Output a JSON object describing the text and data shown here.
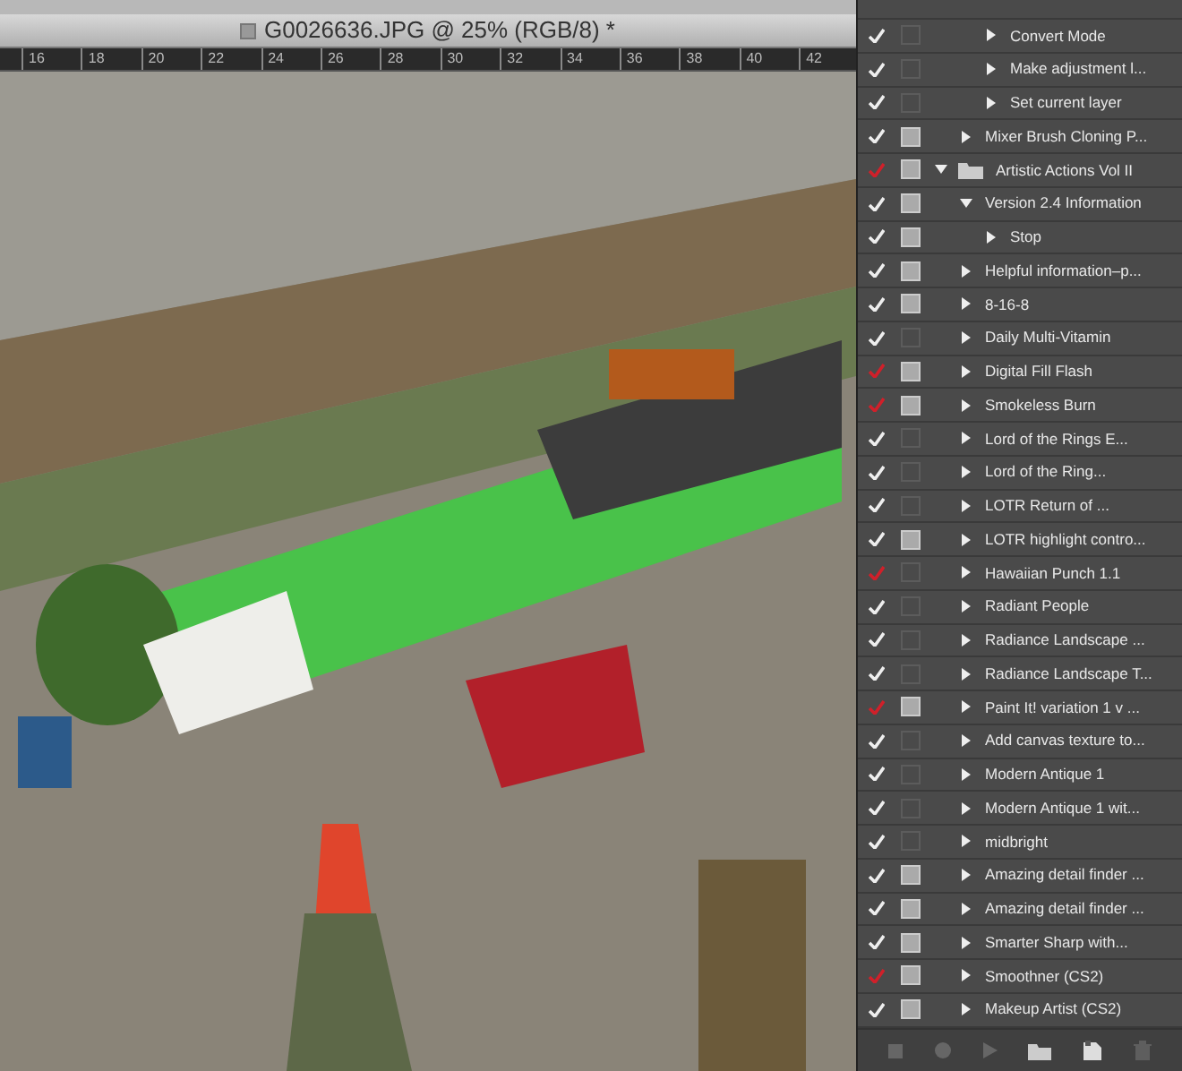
{
  "document": {
    "title": "G0026636.JPG @ 25% (RGB/8) *",
    "ruler_labels": [
      "16",
      "18",
      "20",
      "22",
      "24",
      "26",
      "28",
      "30",
      "32",
      "34",
      "36",
      "38",
      "40",
      "42"
    ],
    "kind": "picture"
  },
  "actions_panel": {
    "items": [
      {
        "kind": "step",
        "label": "Convert Mode",
        "enabled": true,
        "partially_enabled": false,
        "dialog": false,
        "expanded": false
      },
      {
        "kind": "step",
        "label": "Make adjustment l...",
        "enabled": true,
        "partially_enabled": false,
        "dialog": false,
        "expanded": false
      },
      {
        "kind": "step",
        "label": "Set current layer",
        "enabled": true,
        "partially_enabled": false,
        "dialog": false,
        "expanded": false
      },
      {
        "kind": "action",
        "label": "Mixer Brush Cloning P...",
        "enabled": true,
        "partially_enabled": false,
        "dialog": true,
        "expanded": false
      },
      {
        "kind": "set",
        "label": "Artistic Actions Vol II",
        "enabled": true,
        "partially_enabled": true,
        "dialog": true,
        "expanded": true,
        "children": [
          {
            "kind": "action",
            "label": "Version 2.4 Information",
            "enabled": true,
            "partially_enabled": false,
            "dialog": true,
            "expanded": true,
            "children": [
              {
                "kind": "step",
                "label": "Stop",
                "enabled": true,
                "partially_enabled": false,
                "dialog": true,
                "expanded": false
              }
            ]
          },
          {
            "kind": "action",
            "label": "Helpful information–p...",
            "enabled": true,
            "partially_enabled": false,
            "dialog": true,
            "expanded": false
          },
          {
            "kind": "action",
            "label": "8-16-8",
            "enabled": true,
            "partially_enabled": false,
            "dialog": true,
            "expanded": false
          },
          {
            "kind": "action",
            "label": "Daily Multi-Vitamin",
            "enabled": true,
            "partially_enabled": false,
            "dialog": false,
            "expanded": false
          },
          {
            "kind": "action",
            "label": "Digital Fill Flash",
            "enabled": true,
            "partially_enabled": true,
            "dialog": true,
            "expanded": false
          },
          {
            "kind": "action",
            "label": "Smokeless Burn",
            "enabled": true,
            "partially_enabled": true,
            "dialog": true,
            "expanded": false
          },
          {
            "kind": "action",
            "label": "Lord of the Rings E...",
            "enabled": true,
            "partially_enabled": false,
            "dialog": false,
            "expanded": false
          },
          {
            "kind": "action",
            "label": "Lord of the Ring...",
            "enabled": true,
            "partially_enabled": false,
            "dialog": false,
            "expanded": false
          },
          {
            "kind": "action",
            "label": "LOTR Return of ...",
            "enabled": true,
            "partially_enabled": false,
            "dialog": false,
            "expanded": false
          },
          {
            "kind": "action",
            "label": "LOTR highlight contro...",
            "enabled": true,
            "partially_enabled": false,
            "dialog": true,
            "expanded": false
          },
          {
            "kind": "action",
            "label": "Hawaiian Punch 1.1",
            "enabled": true,
            "partially_enabled": true,
            "dialog": false,
            "expanded": false
          },
          {
            "kind": "action",
            "label": "Radiant People",
            "enabled": true,
            "partially_enabled": false,
            "dialog": false,
            "expanded": false
          },
          {
            "kind": "action",
            "label": "Radiance Landscape ...",
            "enabled": true,
            "partially_enabled": false,
            "dialog": false,
            "expanded": false
          },
          {
            "kind": "action",
            "label": "Radiance Landscape T...",
            "enabled": true,
            "partially_enabled": false,
            "dialog": false,
            "expanded": false
          },
          {
            "kind": "action",
            "label": "Paint It! variation 1 v ...",
            "enabled": true,
            "partially_enabled": true,
            "dialog": true,
            "expanded": false
          },
          {
            "kind": "action",
            "label": "Add canvas texture to...",
            "enabled": true,
            "partially_enabled": false,
            "dialog": false,
            "expanded": false
          },
          {
            "kind": "action",
            "label": "Modern Antique 1",
            "enabled": true,
            "partially_enabled": false,
            "dialog": false,
            "expanded": false
          },
          {
            "kind": "action",
            "label": "Modern Antique 1 wit...",
            "enabled": true,
            "partially_enabled": false,
            "dialog": false,
            "expanded": false
          },
          {
            "kind": "action",
            "label": "midbright",
            "enabled": true,
            "partially_enabled": false,
            "dialog": false,
            "expanded": false
          },
          {
            "kind": "action",
            "label": "Amazing detail finder ...",
            "enabled": true,
            "partially_enabled": false,
            "dialog": true,
            "expanded": false
          },
          {
            "kind": "action",
            "label": "Amazing detail finder ...",
            "enabled": true,
            "partially_enabled": false,
            "dialog": true,
            "expanded": false
          },
          {
            "kind": "action",
            "label": "Smarter Sharp with...",
            "enabled": true,
            "partially_enabled": false,
            "dialog": true,
            "expanded": false
          },
          {
            "kind": "action",
            "label": "Smoothner (CS2)",
            "enabled": true,
            "partially_enabled": true,
            "dialog": true,
            "expanded": false
          },
          {
            "kind": "action",
            "label": "Makeup Artist (CS2)",
            "enabled": true,
            "partially_enabled": false,
            "dialog": true,
            "expanded": false
          }
        ]
      }
    ]
  }
}
